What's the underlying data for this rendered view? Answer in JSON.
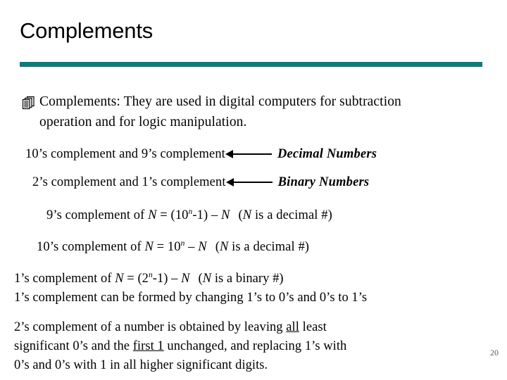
{
  "slide": {
    "title": "Complements",
    "accent_color": "#0B7C7B",
    "background_color": "#FFFFFF",
    "page_number": "20"
  },
  "bullet": {
    "icon": "stacked-pages-icon",
    "text": "Complements: They are used in digital computers for subtraction operation and for logic manipulation."
  },
  "mappings": [
    {
      "left": "10’s complement and 9’s complement",
      "arrow": "left-arrow",
      "right": "Decimal Numbers"
    },
    {
      "left": "2’s complement and 1’s complement",
      "arrow": "left-arrow",
      "right": "Binary Numbers"
    }
  ],
  "formulas": [
    {
      "prefix": "9’s complement of ",
      "var1": "N",
      "eq": " = (10",
      "exp": "n",
      "tail": "-1) – ",
      "var2": "N",
      "note_open": "(",
      "note_var": "N",
      "note_text": " is a decimal #)"
    },
    {
      "prefix": "10’s complement of ",
      "var1": "N",
      "eq": " = 10",
      "exp": "n",
      "tail": " – ",
      "var2": "N",
      "note_open": "(",
      "note_var": "N",
      "note_text": " is a decimal #)"
    }
  ],
  "ones_complement": {
    "line1": {
      "prefix": "1’s complement of ",
      "var1": "N",
      "eq": " = (2",
      "exp": "n",
      "tail": "-1) – ",
      "var2": "N",
      "note_open": "(",
      "note_var": "N",
      "note_text": " is a binary #)"
    },
    "line2": "1’s complement can be formed by changing 1’s to 0’s and 0’s to 1’s"
  },
  "twos_complement": {
    "line1_a": "2’s complement of a number is obtained by leaving ",
    "line1_underline": "all",
    "line1_b": " least",
    "line2_a": "significant 0’s and the ",
    "line2_underline": "first 1",
    "line2_b": " unchanged, and replacing 1’s with",
    "line3": "0’s and 0’s with 1 in all higher significant digits."
  }
}
